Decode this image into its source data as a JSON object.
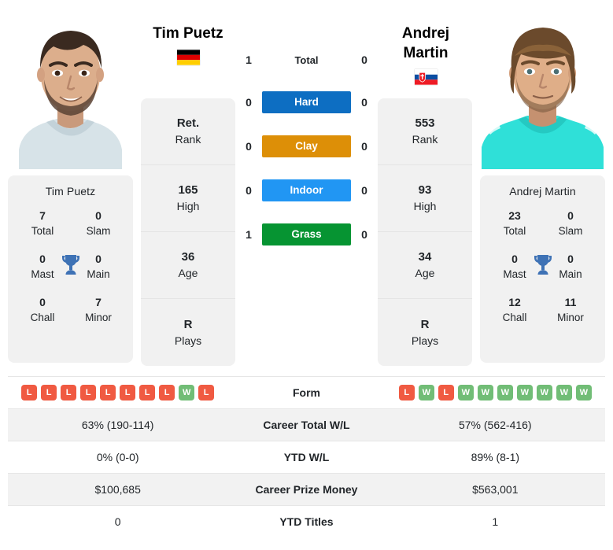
{
  "players": {
    "left": {
      "name": "Tim Puetz",
      "name_lines": [
        "Tim Puetz"
      ],
      "country_flag": "germany-flag",
      "rank": "Ret.",
      "rank_label": "Rank",
      "high": "165",
      "high_label": "High",
      "age": "36",
      "age_label": "Age",
      "plays": "R",
      "plays_label": "Plays",
      "titles_name": "Tim Puetz",
      "titles": {
        "total": "7",
        "total_label": "Total",
        "slam": "0",
        "slam_label": "Slam",
        "mast": "0",
        "mast_label": "Mast",
        "main": "0",
        "main_label": "Main",
        "chall": "0",
        "chall_label": "Chall",
        "minor": "7",
        "minor_label": "Minor"
      },
      "h2h": {
        "total": "1",
        "hard": "0",
        "clay": "0",
        "indoor": "0",
        "grass": "1"
      },
      "form": [
        "L",
        "L",
        "L",
        "L",
        "L",
        "L",
        "L",
        "L",
        "W",
        "L"
      ],
      "career_total_wl": "63% (190-114)",
      "ytd_wl": "0% (0-0)",
      "career_prize_money": "$100,685",
      "ytd_titles": "0"
    },
    "right": {
      "name": "Andrej Martin",
      "name_lines": [
        "Andrej",
        "Martin"
      ],
      "country_flag": "slovakia-flag",
      "rank": "553",
      "rank_label": "Rank",
      "high": "93",
      "high_label": "High",
      "age": "34",
      "age_label": "Age",
      "plays": "R",
      "plays_label": "Plays",
      "titles_name": "Andrej Martin",
      "titles": {
        "total": "23",
        "total_label": "Total",
        "slam": "0",
        "slam_label": "Slam",
        "mast": "0",
        "mast_label": "Mast",
        "main": "0",
        "main_label": "Main",
        "chall": "12",
        "chall_label": "Chall",
        "minor": "11",
        "minor_label": "Minor"
      },
      "h2h": {
        "total": "0",
        "hard": "0",
        "clay": "0",
        "indoor": "0",
        "grass": "0"
      },
      "form": [
        "L",
        "W",
        "L",
        "W",
        "W",
        "W",
        "W",
        "W",
        "W",
        "W"
      ],
      "career_total_wl": "57% (562-416)",
      "ytd_wl": "89% (8-1)",
      "career_prize_money": "$563,001",
      "ytd_titles": "1"
    }
  },
  "surfaces": [
    {
      "key": "total",
      "label": "Total",
      "badge": false,
      "color": ""
    },
    {
      "key": "hard",
      "label": "Hard",
      "badge": true,
      "color": "#0d6ec2"
    },
    {
      "key": "clay",
      "label": "Clay",
      "badge": true,
      "color": "#dd8f07"
    },
    {
      "key": "indoor",
      "label": "Indoor",
      "badge": true,
      "color": "#2196f3"
    },
    {
      "key": "grass",
      "label": "Grass",
      "badge": true,
      "color": "#069432"
    }
  ],
  "table": {
    "rows": [
      {
        "label": "Form",
        "type": "form"
      },
      {
        "label": "Career Total W/L",
        "type": "text",
        "key": "career_total_wl"
      },
      {
        "label": "YTD W/L",
        "type": "text",
        "key": "ytd_wl"
      },
      {
        "label": "Career Prize Money",
        "type": "text",
        "key": "career_prize_money"
      },
      {
        "label": "YTD Titles",
        "type": "text",
        "key": "ytd_titles"
      }
    ]
  },
  "icons": {
    "trophy": "trophy-icon"
  },
  "colors": {
    "win": "#71bd76",
    "loss": "#f05a42",
    "card_bg": "#f1f1f1",
    "row_shade": "#f2f2f2",
    "trophy": "#3e72b5"
  }
}
